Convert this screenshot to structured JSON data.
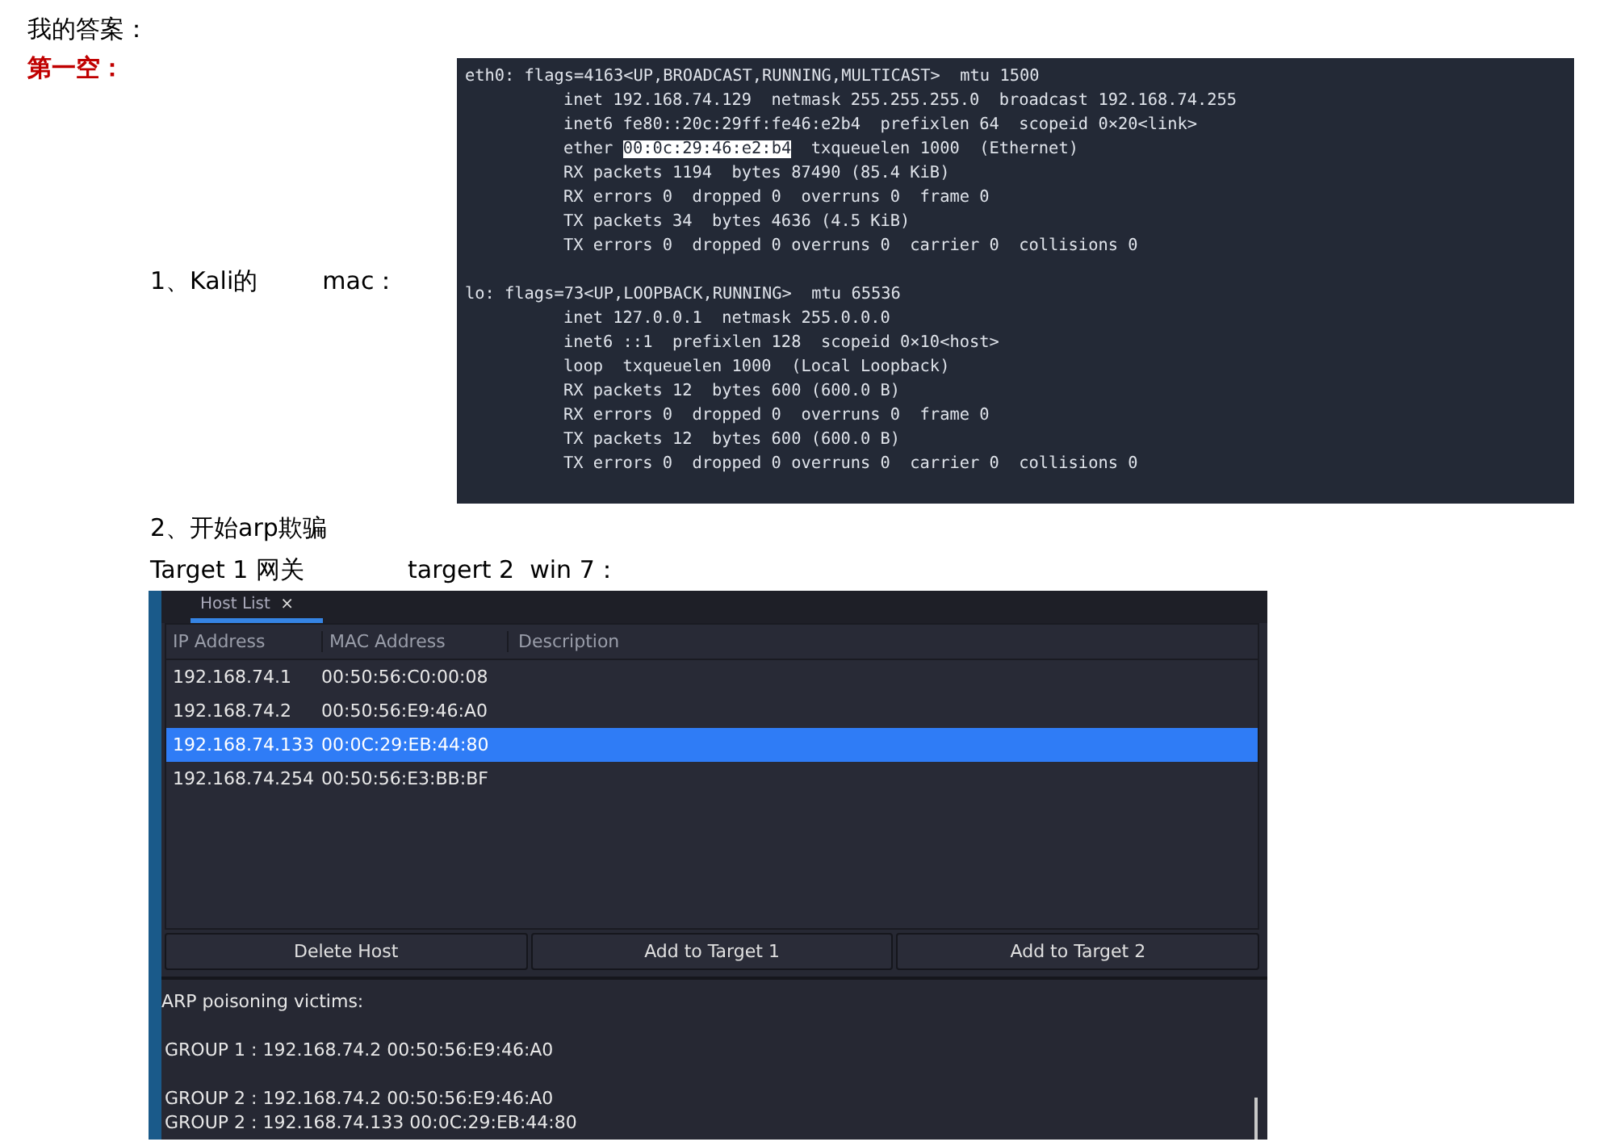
{
  "heading": "我的答案：",
  "blank_label": "第一空：",
  "step_1": {
    "label": "1、Kali的",
    "suffix": "mac："
  },
  "terminal": {
    "lines": [
      {
        "kind": "header",
        "text": "eth0: flags=4163<UP,BROADCAST,RUNNING,MULTICAST>  mtu 1500"
      },
      {
        "kind": "detail",
        "text": "inet 192.168.74.129  netmask 255.255.255.0  broadcast 192.168.74.255"
      },
      {
        "kind": "detail",
        "text": "inet6 fe80::20c:29ff:fe46:e2b4  prefixlen 64  scopeid 0×20<link>"
      },
      {
        "kind": "highlighted",
        "before": "ether ",
        "highlight": "00:0c:29:46:e2:b4",
        "after": "  txqueuelen 1000  (Ethernet)"
      },
      {
        "kind": "detail",
        "text": "RX packets 1194  bytes 87490 (85.4 KiB)"
      },
      {
        "kind": "detail",
        "text": "RX errors 0  dropped 0  overruns 0  frame 0"
      },
      {
        "kind": "detail",
        "text": "TX packets 34  bytes 4636 (4.5 KiB)"
      },
      {
        "kind": "detail",
        "text": "TX errors 0  dropped 0 overruns 0  carrier 0  collisions 0"
      },
      {
        "kind": "header",
        "text": "lo: flags=73<UP,LOOPBACK,RUNNING>  mtu 65536"
      },
      {
        "kind": "detail",
        "text": "inet 127.0.0.1  netmask 255.0.0.0"
      },
      {
        "kind": "detail",
        "text": "inet6 ::1  prefixlen 128  scopeid 0×10<host>"
      },
      {
        "kind": "detail",
        "text": "loop  txqueuelen 1000  (Local Loopback)"
      },
      {
        "kind": "detail",
        "text": "RX packets 12  bytes 600 (600.0 B)"
      },
      {
        "kind": "detail",
        "text": "RX errors 0  dropped 0  overruns 0  frame 0"
      },
      {
        "kind": "detail",
        "text": "TX packets 12  bytes 600 (600.0 B)"
      },
      {
        "kind": "detail",
        "text": "TX errors 0  dropped 0 overruns 0  carrier 0  collisions 0"
      }
    ]
  },
  "step_2": "2、开始arp欺骗",
  "targets_line": {
    "target_1": "Target 1 网关",
    "target_2": "targert 2  win 7："
  },
  "ettercap": {
    "tab": {
      "label": "Host List",
      "close": "×"
    },
    "columns": [
      "IP Address",
      "MAC Address",
      "Description"
    ],
    "rows": [
      {
        "ip": "192.168.74.1",
        "mac": "00:50:56:C0:00:08",
        "selected": false
      },
      {
        "ip": "192.168.74.2",
        "mac": "00:50:56:E9:46:A0",
        "selected": false
      },
      {
        "ip": "192.168.74.133",
        "mac": "00:0C:29:EB:44:80",
        "selected": true
      },
      {
        "ip": "192.168.74.254",
        "mac": "00:50:56:E3:BB:BF",
        "selected": false
      }
    ],
    "buttons": [
      "Delete Host",
      "Add to Target 1",
      "Add to Target 2"
    ],
    "log": {
      "title": "ARP poisoning victims:",
      "groups": [
        [
          "GROUP 1 : 192.168.74.2 00:50:56:E9:46:A0"
        ],
        [
          "GROUP 2 : 192.168.74.2 00:50:56:E9:46:A0",
          "GROUP 2 : 192.168.74.133 00:0C:29:EB:44:80"
        ]
      ]
    }
  }
}
